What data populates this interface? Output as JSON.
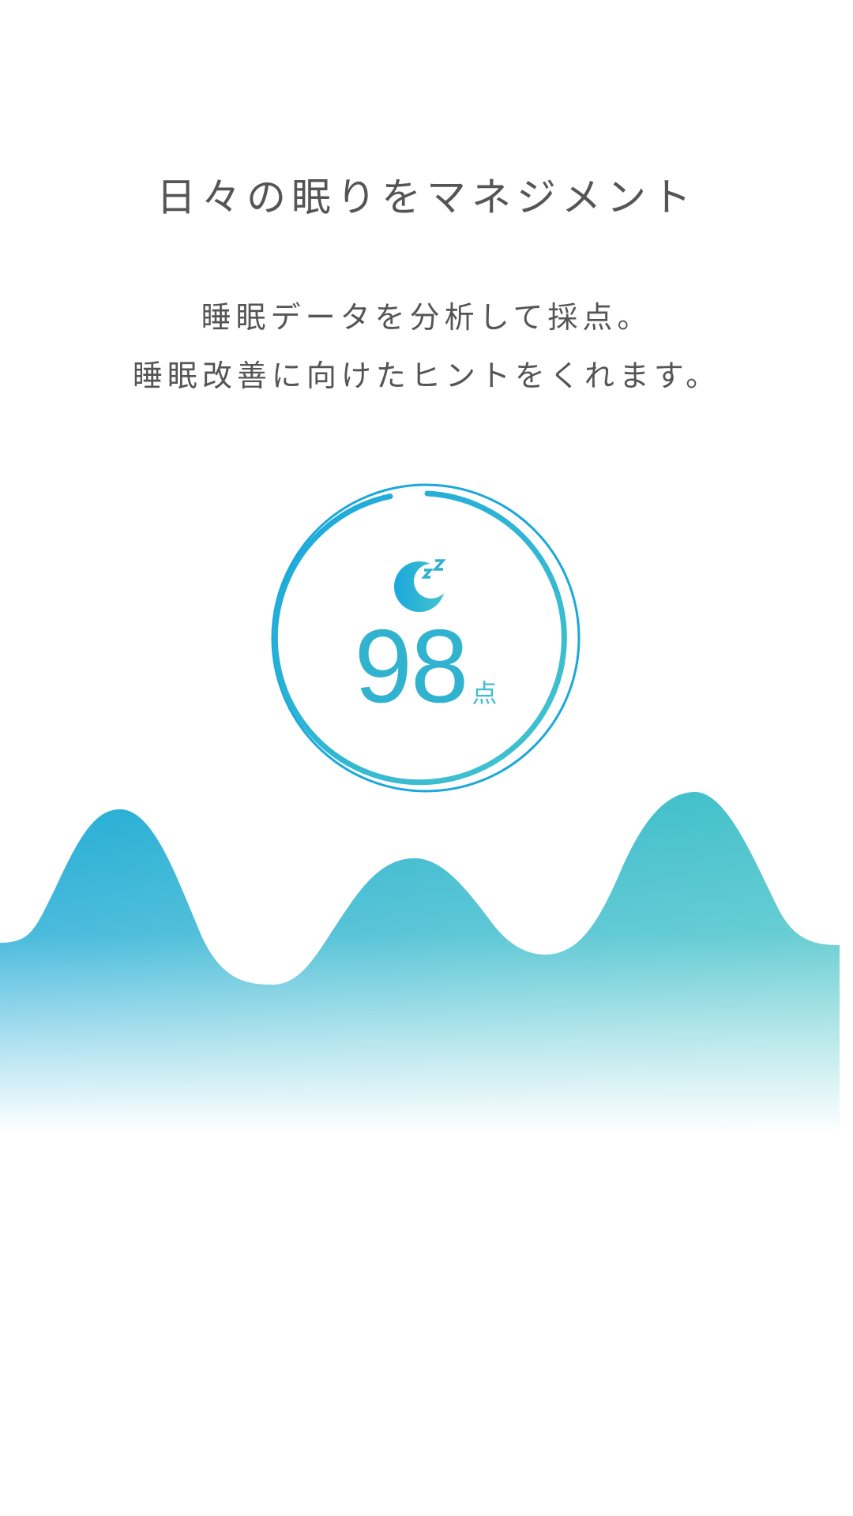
{
  "headline": "日々の眠りをマネジメント",
  "description": {
    "line1": "睡眠データを分析して採点。",
    "line2": "睡眠改善に向けたヒントをくれます。"
  },
  "score": {
    "value": "98",
    "unit": "点",
    "icon": "moon-zzz-icon"
  },
  "colors": {
    "text": "#555555",
    "accent_blue": "#1aa8dc",
    "accent_teal": "#45c4cc"
  }
}
